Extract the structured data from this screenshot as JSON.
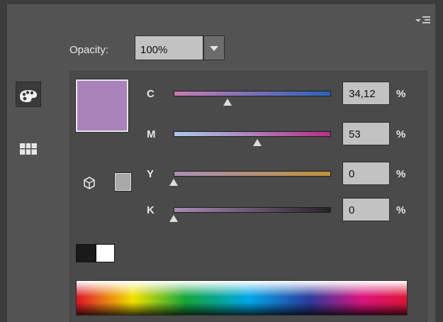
{
  "panel": {
    "opacity": {
      "label": "Opacity:",
      "value": "100%"
    },
    "fill_color": "#a983ba",
    "channels": [
      {
        "label": "C",
        "value": "34,12",
        "unit": "%",
        "level": 0.3412,
        "gradient": [
          "#c97bb4",
          "#2c64b8"
        ]
      },
      {
        "label": "M",
        "value": "53",
        "unit": "%",
        "level": 0.53,
        "gradient": [
          "#a9cbee",
          "#b52f8a"
        ]
      },
      {
        "label": "Y",
        "value": "0",
        "unit": "%",
        "level": 0.0,
        "gradient": [
          "#a88fb6",
          "#c2923a"
        ]
      },
      {
        "label": "K",
        "value": "0",
        "unit": "%",
        "level": 0.0,
        "gradient": [
          "#a98cb8",
          "#262326"
        ]
      }
    ],
    "gamut_color": "#a9a9a9"
  },
  "icons": {
    "panel_menu": "panel-menu-icon",
    "color_mode": "palette-icon",
    "swatches": "grid-icon",
    "out_of_gamut": "cube-icon"
  }
}
